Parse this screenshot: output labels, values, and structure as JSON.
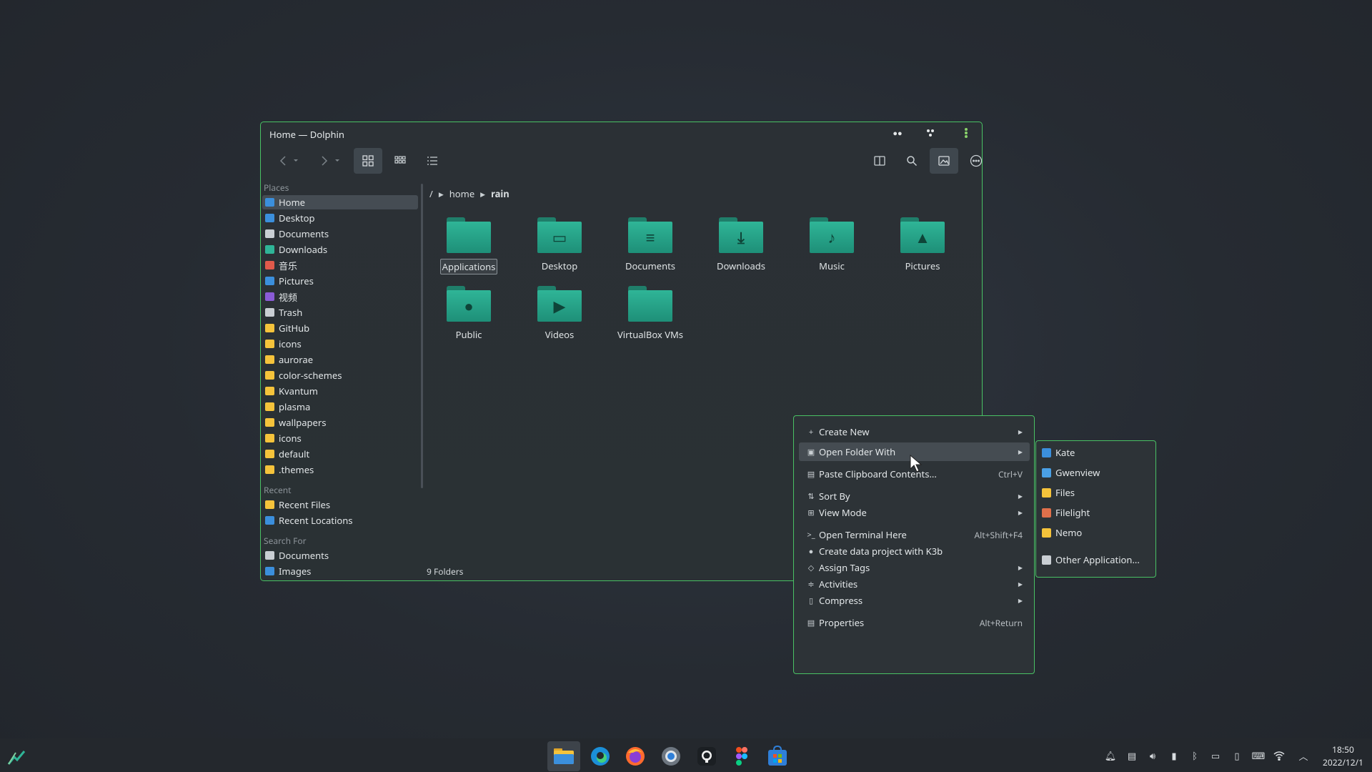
{
  "window": {
    "title": "Home — Dolphin"
  },
  "places": {
    "title": "Places",
    "items": [
      {
        "label": "Home",
        "color": "#3b8fdc",
        "selected": true
      },
      {
        "label": "Desktop",
        "color": "#3b8fdc"
      },
      {
        "label": "Documents",
        "color": "#c9ced3"
      },
      {
        "label": "Downloads",
        "color": "#2fb597"
      },
      {
        "label": "音乐",
        "color": "#e05a4b"
      },
      {
        "label": "Pictures",
        "color": "#3b8fdc"
      },
      {
        "label": "视频",
        "color": "#8a5bd6"
      },
      {
        "label": "Trash",
        "color": "#c9ced3"
      },
      {
        "label": "GitHub",
        "color": "#f5c33b"
      },
      {
        "label": "icons",
        "color": "#f5c33b"
      },
      {
        "label": "aurorae",
        "color": "#f5c33b"
      },
      {
        "label": "color-schemes",
        "color": "#f5c33b"
      },
      {
        "label": "Kvantum",
        "color": "#f5c33b"
      },
      {
        "label": "plasma",
        "color": "#f5c33b"
      },
      {
        "label": "wallpapers",
        "color": "#f5c33b"
      },
      {
        "label": "icons",
        "color": "#f5c33b"
      },
      {
        "label": "default",
        "color": "#f5c33b"
      },
      {
        "label": ".themes",
        "color": "#f5c33b"
      }
    ]
  },
  "recent": {
    "title": "Recent",
    "items": [
      {
        "label": "Recent Files",
        "color": "#f5c33b"
      },
      {
        "label": "Recent Locations",
        "color": "#3b8fdc"
      }
    ]
  },
  "search_for": {
    "title": "Search For",
    "items": [
      {
        "label": "Documents",
        "color": "#c9ced3"
      },
      {
        "label": "Images",
        "color": "#3b8fdc"
      }
    ]
  },
  "breadcrumb": {
    "root": "/",
    "home": "home",
    "current": "rain"
  },
  "folders": [
    {
      "label": "Applications",
      "glyph": ""
    },
    {
      "label": "Desktop",
      "glyph": "▭"
    },
    {
      "label": "Documents",
      "glyph": "≡"
    },
    {
      "label": "Downloads",
      "glyph": "⤓"
    },
    {
      "label": "Music",
      "glyph": "♪"
    },
    {
      "label": "Pictures",
      "glyph": "▲"
    },
    {
      "label": "Public",
      "glyph": "●"
    },
    {
      "label": "Videos",
      "glyph": "▶"
    },
    {
      "label": "VirtualBox VMs",
      "glyph": ""
    }
  ],
  "status": "9 Folders",
  "context_menu": {
    "items": [
      {
        "label": "Create New",
        "icon": "+",
        "shortcut": "",
        "submenu": true
      },
      {
        "label": "Open Folder With",
        "icon": "▣",
        "shortcut": "",
        "submenu": true,
        "highlighted": true
      },
      {
        "label": "Paste Clipboard Contents...",
        "icon": "▤",
        "shortcut": "Ctrl+V",
        "submenu": false
      },
      {
        "label": "Sort By",
        "icon": "⇅",
        "shortcut": "",
        "submenu": true
      },
      {
        "label": "View Mode",
        "icon": "⊞",
        "shortcut": "",
        "submenu": true
      },
      {
        "label": "Open Terminal Here",
        "icon": ">_",
        "shortcut": "Alt+Shift+F4",
        "submenu": false
      },
      {
        "label": "Create data project with K3b",
        "icon": "●",
        "shortcut": "",
        "submenu": false
      },
      {
        "label": "Assign Tags",
        "icon": "◇",
        "shortcut": "",
        "submenu": true
      },
      {
        "label": "Activities",
        "icon": "≑",
        "shortcut": "",
        "submenu": true
      },
      {
        "label": "Compress",
        "icon": "▯",
        "shortcut": "",
        "submenu": true
      },
      {
        "label": "Properties",
        "icon": "▤",
        "shortcut": "Alt+Return",
        "submenu": false
      }
    ]
  },
  "submenu": {
    "items": [
      {
        "label": "Kate",
        "color": "#3b8fdc"
      },
      {
        "label": "Gwenview",
        "color": "#4aa0e6"
      },
      {
        "label": "Files",
        "color": "#f5c33b"
      },
      {
        "label": "Filelight",
        "color": "#e0704b"
      },
      {
        "label": "Nemo",
        "color": "#f5c33b"
      },
      {
        "label": "Other Application...",
        "color": "#c9ced3"
      }
    ]
  },
  "taskbar": {
    "apps": [
      "file-manager",
      "edge",
      "firefox",
      "settings",
      "github",
      "figma",
      "store"
    ],
    "clock": {
      "time": "18:50",
      "date": "2022/12/1"
    }
  }
}
